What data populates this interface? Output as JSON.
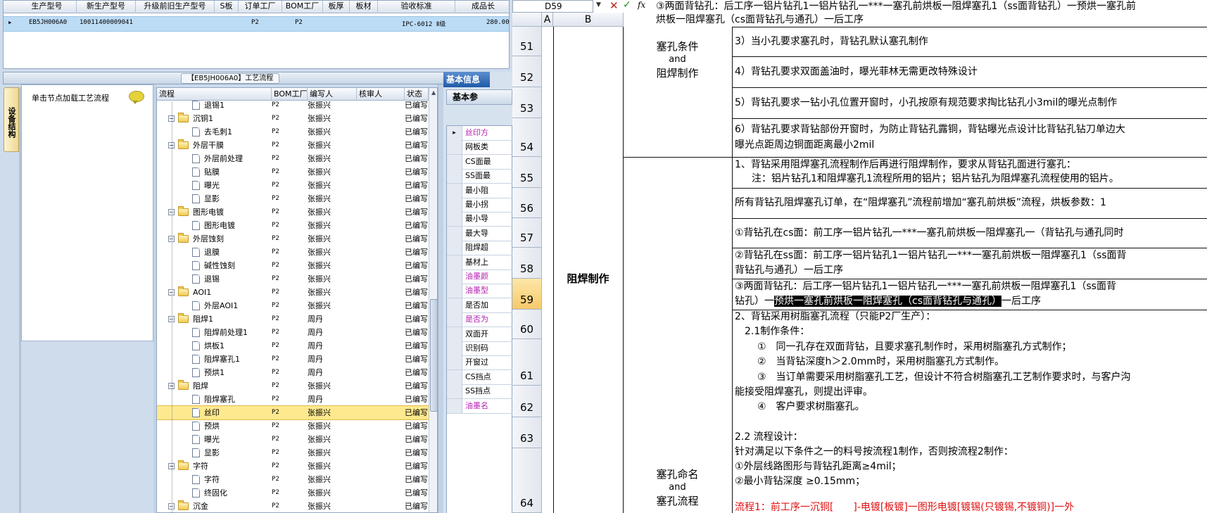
{
  "top_grid": {
    "columns": [
      "生产型号",
      "新生产型号",
      "升级前旧生产型号",
      "S板",
      "订单工厂",
      "BOM工厂",
      "板厚",
      "板材",
      "验收标准",
      "成品长"
    ],
    "row": {
      "indicator": "▸",
      "prod_model": "EB5JH006A0",
      "new_model": "10011400009041",
      "order_factory": "P2",
      "bom_factory": "P2",
      "standard": "IPC-6012 Ⅱ级",
      "length": "280.00"
    }
  },
  "flow_panel": {
    "title": "【EB5JH006A0】工艺流程",
    "vertical_tab": "设备结构",
    "click_hint": "单击节点加载工艺流程"
  },
  "tree": {
    "columns": [
      "流程",
      "BOM工厂",
      "编写人",
      "核审人",
      "状态"
    ],
    "rows": [
      {
        "name": "退锡1",
        "level": 2,
        "type": "doc",
        "bom": "P2",
        "writer": "张振兴",
        "status": "已编写"
      },
      {
        "name": "沉铜1",
        "level": 1,
        "type": "folder",
        "bom": "P2",
        "writer": "张振兴",
        "status": "已编写"
      },
      {
        "name": "去毛刺1",
        "level": 2,
        "type": "doc",
        "bom": "P2",
        "writer": "张振兴",
        "status": "已编写"
      },
      {
        "name": "外层干膜",
        "level": 1,
        "type": "folder",
        "bom": "P2",
        "writer": "张振兴",
        "status": "已编写"
      },
      {
        "name": "外层前处理",
        "level": 2,
        "type": "doc",
        "bom": "P2",
        "writer": "张振兴",
        "status": "已编写"
      },
      {
        "name": "贴膜",
        "level": 2,
        "type": "doc",
        "bom": "P2",
        "writer": "张振兴",
        "status": "已编写"
      },
      {
        "name": "曝光",
        "level": 2,
        "type": "doc",
        "bom": "P2",
        "writer": "张振兴",
        "status": "已编写"
      },
      {
        "name": "显影",
        "level": 2,
        "type": "doc",
        "bom": "P2",
        "writer": "张振兴",
        "status": "已编写"
      },
      {
        "name": "图形电镀",
        "level": 1,
        "type": "folder",
        "bom": "P2",
        "writer": "张振兴",
        "status": "已编写"
      },
      {
        "name": "图形电镀",
        "level": 2,
        "type": "doc",
        "bom": "P2",
        "writer": "张振兴",
        "status": "已编写"
      },
      {
        "name": "外层蚀刻",
        "level": 1,
        "type": "folder",
        "bom": "P2",
        "writer": "张振兴",
        "status": "已编写"
      },
      {
        "name": "退膜",
        "level": 2,
        "type": "doc",
        "bom": "P2",
        "writer": "张振兴",
        "status": "已编写"
      },
      {
        "name": "碱性蚀刻",
        "level": 2,
        "type": "doc",
        "bom": "P2",
        "writer": "张振兴",
        "status": "已编写"
      },
      {
        "name": "退锡",
        "level": 2,
        "type": "doc",
        "bom": "P2",
        "writer": "张振兴",
        "status": "已编写"
      },
      {
        "name": "AOI1",
        "level": 1,
        "type": "folder",
        "bom": "P2",
        "writer": "张振兴",
        "status": "已编写"
      },
      {
        "name": "外层AOI1",
        "level": 2,
        "type": "doc",
        "bom": "P2",
        "writer": "张振兴",
        "status": "已编写"
      },
      {
        "name": "阻焊1",
        "level": 1,
        "type": "folder",
        "bom": "P2",
        "writer": "周丹",
        "status": "已编写"
      },
      {
        "name": "阻焊前处理1",
        "level": 2,
        "type": "doc",
        "bom": "P2",
        "writer": "周丹",
        "status": "已编写"
      },
      {
        "name": "烘板1",
        "level": 2,
        "type": "doc",
        "bom": "P2",
        "writer": "周丹",
        "status": "已编写"
      },
      {
        "name": "阻焊塞孔1",
        "level": 2,
        "type": "doc",
        "bom": "P2",
        "writer": "周丹",
        "status": "已编写"
      },
      {
        "name": "预烘1",
        "level": 2,
        "type": "doc",
        "bom": "P2",
        "writer": "周丹",
        "status": "已编写"
      },
      {
        "name": "阻焊",
        "level": 1,
        "type": "folder",
        "bom": "P2",
        "writer": "张振兴",
        "status": "已编写"
      },
      {
        "name": "阻焊塞孔",
        "level": 2,
        "type": "doc",
        "bom": "P2",
        "writer": "周丹",
        "status": "已编写"
      },
      {
        "name": "丝印",
        "level": 2,
        "type": "doc",
        "bom": "P2",
        "writer": "张振兴",
        "status": "已编写",
        "selected": true
      },
      {
        "name": "预烘",
        "level": 2,
        "type": "doc",
        "bom": "P2",
        "writer": "张振兴",
        "status": "已编写"
      },
      {
        "name": "曝光",
        "level": 2,
        "type": "doc",
        "bom": "P2",
        "writer": "张振兴",
        "status": "已编写"
      },
      {
        "name": "显影",
        "level": 2,
        "type": "doc",
        "bom": "P2",
        "writer": "张振兴",
        "status": "已编写"
      },
      {
        "name": "字符",
        "level": 1,
        "type": "folder",
        "bom": "P2",
        "writer": "张振兴",
        "status": "已编写"
      },
      {
        "name": "字符",
        "level": 2,
        "type": "doc",
        "bom": "P2",
        "writer": "张振兴",
        "status": "已编写"
      },
      {
        "name": "终固化",
        "level": 2,
        "type": "doc",
        "bom": "P2",
        "writer": "张振兴",
        "status": "已编写"
      },
      {
        "name": "沉金",
        "level": 1,
        "type": "folder",
        "bom": "P2",
        "writer": "张振兴",
        "status": "已编写"
      }
    ]
  },
  "info_panel": {
    "tab": "基本信息",
    "sub_tab": "基本参",
    "rows": [
      {
        "label": "丝印方",
        "magenta": true,
        "current": true
      },
      {
        "label": "网板类",
        "magenta": false
      },
      {
        "label": "CS面最",
        "magenta": false
      },
      {
        "label": "SS面最",
        "magenta": false
      },
      {
        "label": "最小阻",
        "magenta": false
      },
      {
        "label": "最小拐",
        "magenta": false
      },
      {
        "label": "最小导",
        "magenta": false
      },
      {
        "label": "最大导",
        "magenta": false
      },
      {
        "label": "阻焊超",
        "magenta": false
      },
      {
        "label": "基材上",
        "magenta": false
      },
      {
        "label": "油墨颜",
        "magenta": true
      },
      {
        "label": "油墨型",
        "magenta": true
      },
      {
        "label": "是否加",
        "magenta": false
      },
      {
        "label": "是否为",
        "magenta": true
      },
      {
        "label": "双面开",
        "magenta": false
      },
      {
        "label": "识别码",
        "magenta": false
      },
      {
        "label": "开窗过",
        "magenta": false
      },
      {
        "label": "CS挡点",
        "magenta": false
      },
      {
        "label": "SS挡点",
        "magenta": false
      },
      {
        "label": "油墨名",
        "magenta": true
      }
    ]
  },
  "excel": {
    "name_box": "D59",
    "formula_line1": "③两面背钻孔：后工序一铝片钻孔1一铝片钻孔一***一塞孔前烘板一阻焊塞孔1（ss面背钻孔）一预烘一塞孔前",
    "formula_line2": "烘板一阻焊塞孔（cs面背钻孔与通孔）一后工序",
    "columns": [
      "A",
      "B"
    ],
    "rows": [
      "51",
      "52",
      "53",
      "54",
      "55",
      "56",
      "57",
      "58",
      "59",
      "60",
      "61",
      "62",
      "63",
      "64"
    ],
    "active_row": "59",
    "merged_b": "阻焊制作",
    "cat1": [
      "塞孔条件",
      "and",
      "阻焊制作"
    ],
    "cat2": [
      "塞孔命名",
      "and",
      "塞孔流程"
    ],
    "d51": "3）当小孔要求塞孔时，背钻孔默认塞孔制作",
    "d52": "4）背钻孔要求双面盖油时，曝光菲林无需更改特殊设计",
    "d53": "5）背钻孔要求一钻小孔位置开窗时，小孔按原有规范要求掏比钻孔小3mil的曝光点制作",
    "d54a": "6）背钻孔要求背钻部份开窗时，为防止背钻孔露铜，背钻曝光点设计比背钻孔钻刀单边大",
    "d54b": "曝光点距周边铜面距离最小2mil",
    "d55a": "1、背钻采用阻焊塞孔流程制作后再进行阻焊制作，要求从背钻孔面进行塞孔：",
    "d55b": "注：铝片钻孔1和阻焊塞孔1流程所用的铝片；铝片钻孔为阻焊塞孔流程使用的铝片。",
    "d56": "所有背钻孔阻焊塞孔订单，在“阻焊塞孔”流程前增加“塞孔前烘板”流程，烘板参数：1",
    "d57": "①背钻孔在cs面：前工序一铝片钻孔一***一塞孔前烘板一阻焊塞孔一（背钻孔与通孔同时",
    "d58a": "②背钻孔在ss面：前工序一铝片钻孔1一铝片钻孔一***一塞孔前烘板一阻焊塞孔1（ss面背",
    "d58b": "背钻孔与通孔）一后工序",
    "d59a": "③两面背钻孔：后工序一铝片钻孔1一铝片钻孔一***一塞孔前烘板一阻焊塞孔1（ss面背",
    "d59b_pre": "钻孔）一",
    "d59b_sel": "预烘一塞孔前烘板一阻焊塞孔（cs面背钻孔与通孔）",
    "d59b_post": "一后工序",
    "d60a": "2、背钻采用树脂塞孔流程（只能P2厂生产）：",
    "d60b": "2.1制作条件：",
    "d61a": "①　同一孔存在双面背钻，且要求塞孔制作时，采用树脂塞孔方式制作；",
    "d61b": "②　当背钻深度h＞2.0mm时，采用树脂塞孔方式制作。",
    "d62a": "③　当订单需要采用树脂塞孔工艺，但设计不符合树脂塞孔工艺制作要求时，与客户沟",
    "d62b": "能接受阻焊塞孔，则提出评审。",
    "d63a": "④　客户要求树脂塞孔。",
    "d64a": "2.2 流程设计：",
    "d64b": "针对满足以下条件之一的料号按流程1制作，否则按流程2制作：",
    "d64c": "①外层线路图形与背钻孔距离≥4mil；",
    "d64d": "②最小背钻深度 ≥0.15mm；",
    "d64e": "流程1：前工序一沉铜[　　]-电镀[板镀]一图形电镀[镀锡(只镀锡,不镀铜)]一外"
  }
}
